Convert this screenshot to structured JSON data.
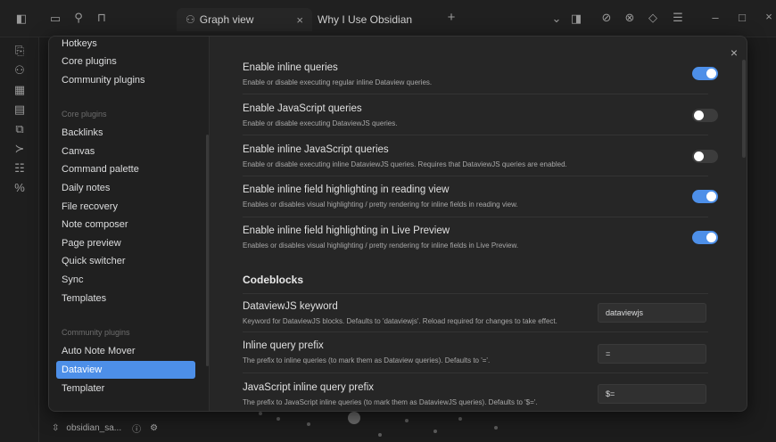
{
  "tabs": [
    {
      "label": "Graph view",
      "icon": "graph-icon"
    },
    {
      "label": "Why I Use Obsidian"
    }
  ],
  "window": {
    "close_glyph": "×"
  },
  "sidebar_nav": [
    {
      "label": "Hotkeys"
    },
    {
      "label": "Core plugins"
    },
    {
      "label": "Community plugins"
    },
    {
      "label": "Core plugins",
      "group": true
    },
    {
      "label": "Backlinks"
    },
    {
      "label": "Canvas"
    },
    {
      "label": "Command palette"
    },
    {
      "label": "Daily notes"
    },
    {
      "label": "File recovery"
    },
    {
      "label": "Note composer"
    },
    {
      "label": "Page preview"
    },
    {
      "label": "Quick switcher"
    },
    {
      "label": "Sync"
    },
    {
      "label": "Templates"
    },
    {
      "label": "Community plugins",
      "group": true
    },
    {
      "label": "Auto Note Mover"
    },
    {
      "label": "Dataview",
      "active": true
    },
    {
      "label": "Templater"
    }
  ],
  "settings": [
    {
      "name": "Enable inline queries",
      "desc": "Enable or disable executing regular inline Dataview queries.",
      "enabled": true
    },
    {
      "name": "Enable JavaScript queries",
      "desc": "Enable or disable executing DataviewJS queries.",
      "enabled": false
    },
    {
      "name": "Enable inline JavaScript queries",
      "desc": "Enable or disable executing inline DataviewJS queries. Requires that DataviewJS queries are enabled.",
      "enabled": false
    },
    {
      "name": "Enable inline field highlighting in reading view",
      "desc": "Enables or disables visual highlighting / pretty rendering for inline fields in reading view.",
      "enabled": true
    },
    {
      "name": "Enable inline field highlighting in Live Preview",
      "desc": "Enables or disables visual highlighting / pretty rendering for inline fields in Live Preview.",
      "enabled": true
    }
  ],
  "codeblocks": {
    "heading": "Codeblocks",
    "fields": [
      {
        "name": "DataviewJS keyword",
        "desc": "Keyword for DataviewJS blocks. Defaults to 'dataviewjs'. Reload required for changes to take effect.",
        "value": "dataviewjs"
      },
      {
        "name": "Inline query prefix",
        "desc": "The prefix to inline queries (to mark them as Dataview queries). Defaults to '='.",
        "value": "="
      },
      {
        "name": "JavaScript inline query prefix",
        "desc": "The prefix to JavaScript inline queries (to mark them as DataviewJS queries). Defaults to '$='.",
        "value": "$="
      }
    ]
  },
  "statusbar": {
    "vault": "obsidian_sa..."
  },
  "colors": {
    "accent": "#4d8fe8",
    "background": "#262626",
    "sidebar": "#202020"
  }
}
